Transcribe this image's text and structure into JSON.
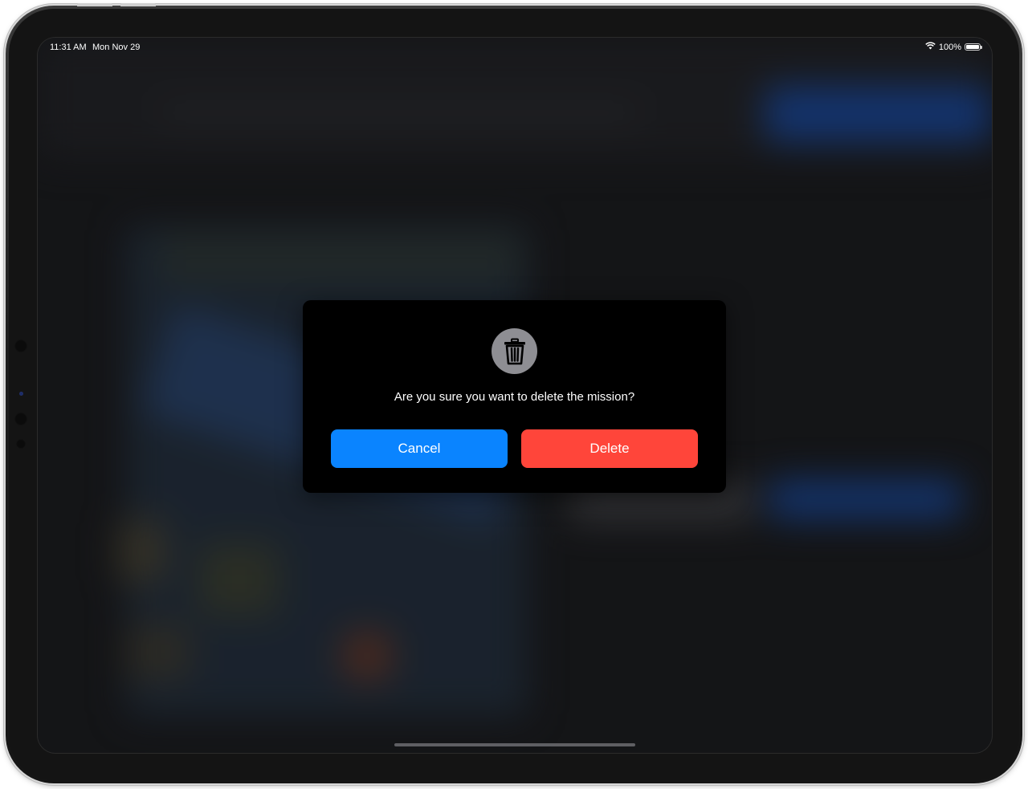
{
  "status_bar": {
    "time": "11:31 AM",
    "date": "Mon Nov 29",
    "battery_text": "100%",
    "battery_level": 1.0,
    "icons": [
      "wifi-icon",
      "battery-icon"
    ]
  },
  "dialog": {
    "icon": "trash-icon",
    "message": "Are you sure you want to delete the mission?",
    "cancel_label": "Cancel",
    "delete_label": "Delete"
  },
  "colors": {
    "cancel": "#0a84ff",
    "delete": "#ff453a",
    "dialog_bg": "#000000",
    "icon_circle": "#8e8e93"
  }
}
